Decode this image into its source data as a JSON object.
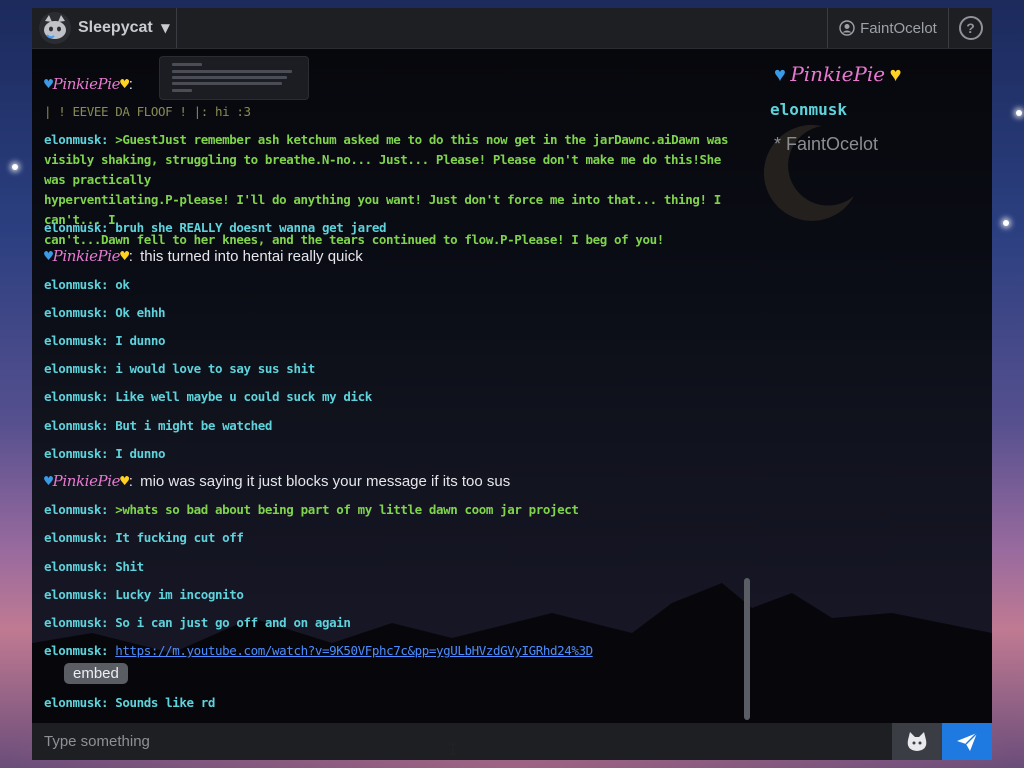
{
  "header": {
    "app_name": "Sleepycat",
    "current_user": "FaintOcelot",
    "help_label": "?"
  },
  "messages": [
    {
      "name": "PinkiePie",
      "sep": ":",
      "text": ""
    },
    {
      "text": "| ! EEVEE DA FLOOF ! |: hi :3"
    },
    {
      "name": "elonmusk",
      "sep": ":",
      "lines": [
        ">GuestJust remember ash ketchum asked me to do this now get in the jarDawnc.aiDawn was",
        "visibly shaking, struggling to breathe.N-no... Just... Please! Please don't make me do this!She was practically",
        "hyperventilating.P-please! I'll do anything you want! Just don't force me into that... thing! I can't... I",
        "can't...Dawn fell to her knees, and the tears continued to flow.P-Please! I beg of you!"
      ]
    },
    {
      "name": "elonmusk",
      "sep": ":",
      "text": "bruh she REALLY doesnt wanna get jared"
    },
    {
      "name": "PinkiePie",
      "sep": ":",
      "text": "this turned into hentai really quick"
    },
    {
      "name": "elonmusk",
      "sep": ":",
      "text": "ok"
    },
    {
      "name": "elonmusk",
      "sep": ":",
      "text": "Ok ehhh"
    },
    {
      "name": "elonmusk",
      "sep": ":",
      "text": "I dunno"
    },
    {
      "name": "elonmusk",
      "sep": ":",
      "text": "i would love to say sus shit"
    },
    {
      "name": "elonmusk",
      "sep": ":",
      "text": "Like well maybe u could suck my dick"
    },
    {
      "name": "elonmusk",
      "sep": ":",
      "text": "But i might be watched"
    },
    {
      "name": "elonmusk",
      "sep": ":",
      "text": "I dunno"
    },
    {
      "name": "PinkiePie",
      "sep": ":",
      "text": "mio was saying it just blocks your message if its too sus"
    },
    {
      "name": "elonmusk",
      "sep": ":",
      "text": ">whats so bad about being part of my little dawn coom jar project"
    },
    {
      "name": "elonmusk",
      "sep": ":",
      "text": "It fucking cut off"
    },
    {
      "name": "elonmusk",
      "sep": ":",
      "text": "Shit"
    },
    {
      "name": "elonmusk",
      "sep": ":",
      "text": "Lucky im incognito"
    },
    {
      "name": "elonmusk",
      "sep": ":",
      "text": "So i can just go off and on again"
    },
    {
      "name": "elonmusk",
      "sep": ":",
      "link": "https://m.youtube.com/watch?v=9K50VFphc7c&pp=ygULbHVzdGVyIGRhd24%3D"
    },
    {
      "name": "elonmusk",
      "sep": ":",
      "text": "Sounds like rd"
    }
  ],
  "embed_label": "embed",
  "userlist": {
    "pinkie": "PinkiePie",
    "elon": "elonmusk",
    "faint": "* FaintOcelot"
  },
  "composer": {
    "placeholder": "Type something"
  },
  "colors": {
    "accent": "#1e7ae0",
    "name_cyan": "#5ed3dc",
    "greentext": "#7fd44c",
    "pinkie": "#e879d0"
  },
  "icons": {
    "logo": "cat-face-icon",
    "user": "user-circle-icon",
    "help": "question-circle-icon",
    "emote": "cat-emote-icon",
    "send": "paper-plane-icon"
  }
}
